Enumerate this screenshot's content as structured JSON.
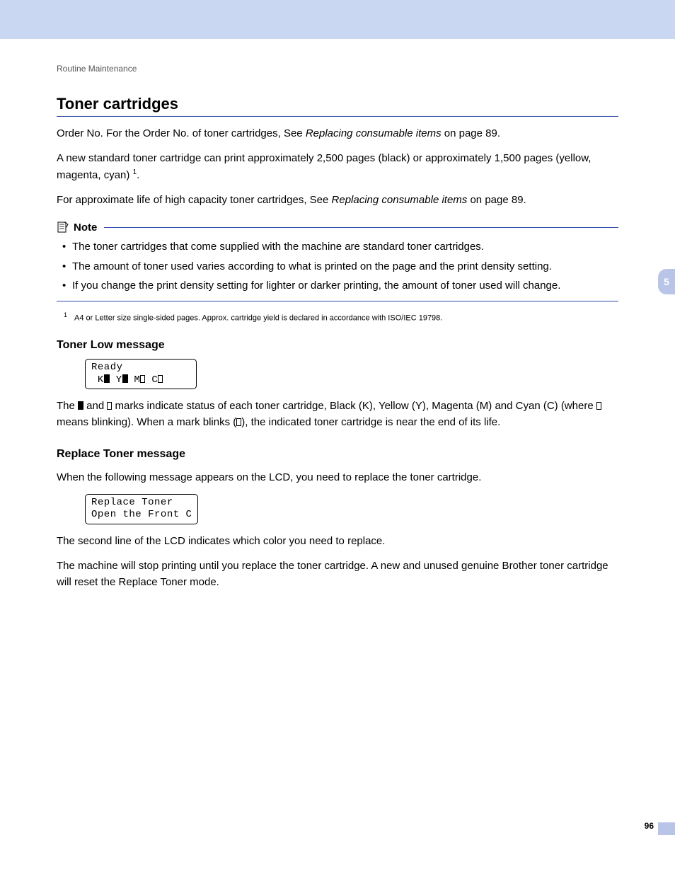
{
  "breadcrumb": "Routine Maintenance",
  "section_title": "Toner cartridges",
  "p1_a": "Order No. For the Order No. of toner cartridges, See ",
  "p1_link": "Replacing consumable items",
  "p1_b": " on page 89.",
  "p2_a": "A new standard toner cartridge can print approximately 2,500 pages (black) or approximately 1,500 pages (yellow, magenta, cyan) ",
  "p2_sup": "1",
  "p2_b": ".",
  "p3_a": "For approximate life of high capacity toner cartridges, See ",
  "p3_link": "Replacing consumable items",
  "p3_b": " on page 89.",
  "note_label": "Note",
  "note_items": {
    "0": "The toner cartridges that come supplied with the machine are standard toner cartridges.",
    "1": "The amount of toner used varies according to what is printed on the page and the print density setting.",
    "2": "If you change the print density setting for lighter or darker printing, the amount of toner used will change."
  },
  "footnote_num": "1",
  "footnote_text": "A4 or Letter size single-sided pages. Approx. cartridge yield is declared in accordance with ISO/IEC 19798.",
  "sub1": "Toner Low message",
  "lcd1_line1": "Ready",
  "lcd1_k": "K",
  "lcd1_y": "Y",
  "lcd1_m": "M",
  "lcd1_c": "C",
  "p4_a": "The ",
  "p4_b": " and ",
  "p4_c": " marks indicate status of each toner cartridge, Black (K), Yellow (Y), Magenta (M) and Cyan (C) (where ",
  "p4_d": " means blinking). When a mark blinks (",
  "p4_e": "), the indicated toner cartridge is near the end of its life.",
  "sub2": "Replace Toner message",
  "p5": "When the following message appears on the LCD, you need to replace the toner cartridge.",
  "lcd2_line1": "Replace Toner",
  "lcd2_line2": "Open the Front C",
  "p6": "The second line of the LCD indicates which color you need to replace.",
  "p7": "The machine will stop printing until you replace the toner cartridge. A new and unused genuine Brother toner cartridge will reset the Replace Toner mode.",
  "chapter_tab": "5",
  "page_number": "96"
}
